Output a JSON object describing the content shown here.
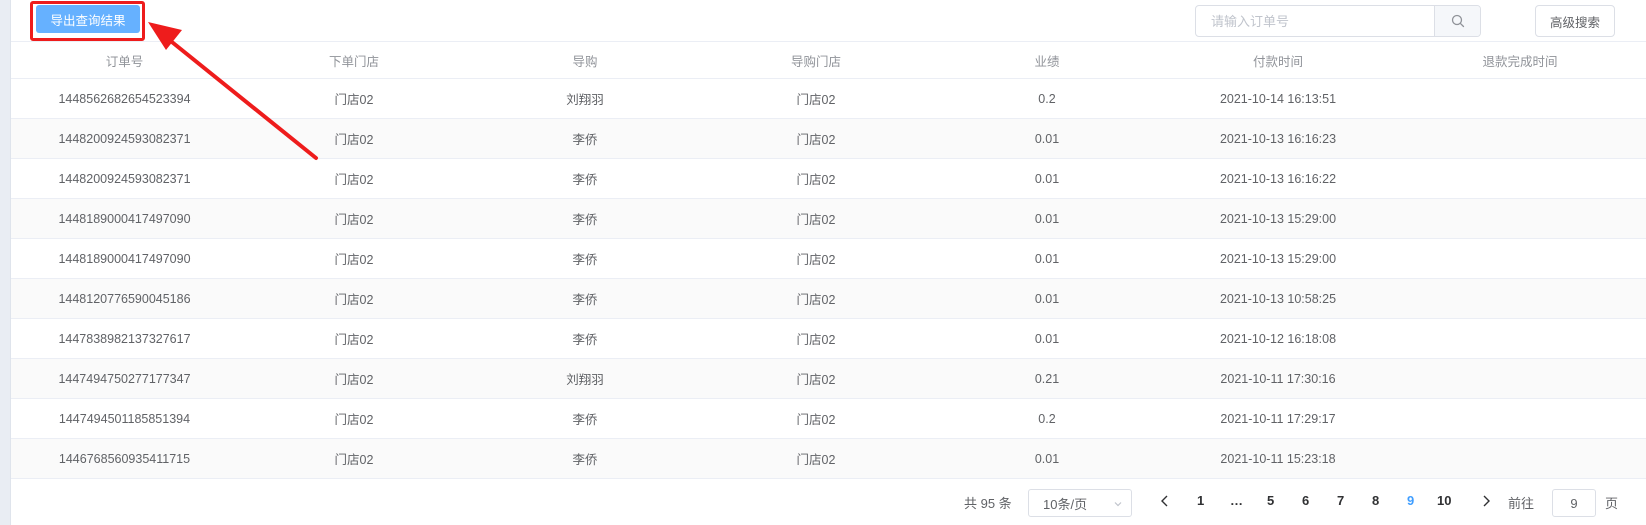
{
  "toolbar": {
    "export_label": "导出查询结果",
    "search_placeholder": "请输入订单号",
    "search_value": "",
    "advanced_label": "高级搜索"
  },
  "table": {
    "headers": [
      "订单号",
      "下单门店",
      "导购",
      "导购门店",
      "业绩",
      "付款时间",
      "退款完成时间"
    ],
    "rows": [
      [
        "1448562682654523394",
        "门店02",
        "刘翔羽",
        "门店02",
        "0.2",
        "2021-10-14 16:13:51",
        ""
      ],
      [
        "1448200924593082371",
        "门店02",
        "李侨",
        "门店02",
        "0.01",
        "2021-10-13 16:16:23",
        ""
      ],
      [
        "1448200924593082371",
        "门店02",
        "李侨",
        "门店02",
        "0.01",
        "2021-10-13 16:16:22",
        ""
      ],
      [
        "1448189000417497090",
        "门店02",
        "李侨",
        "门店02",
        "0.01",
        "2021-10-13 15:29:00",
        ""
      ],
      [
        "1448189000417497090",
        "门店02",
        "李侨",
        "门店02",
        "0.01",
        "2021-10-13 15:29:00",
        ""
      ],
      [
        "1448120776590045186",
        "门店02",
        "李侨",
        "门店02",
        "0.01",
        "2021-10-13 10:58:25",
        ""
      ],
      [
        "1447838982137327617",
        "门店02",
        "李侨",
        "门店02",
        "0.01",
        "2021-10-12 16:18:08",
        ""
      ],
      [
        "1447494750277177347",
        "门店02",
        "刘翔羽",
        "门店02",
        "0.21",
        "2021-10-11 17:30:16",
        ""
      ],
      [
        "1447494501185851394",
        "门店02",
        "李侨",
        "门店02",
        "0.2",
        "2021-10-11 17:29:17",
        ""
      ],
      [
        "1446768560935411715",
        "门店02",
        "李侨",
        "门店02",
        "0.01",
        "2021-10-11 15:23:18",
        ""
      ]
    ]
  },
  "pagination": {
    "total_text": "共 95 条",
    "page_size": "10条/页",
    "pages": [
      "1",
      "…",
      "5",
      "6",
      "7",
      "8",
      "9",
      "10"
    ],
    "current": "9",
    "goto_label": "前往",
    "goto_value": "9",
    "unit_label": "页"
  },
  "colors": {
    "primary": "#409eff",
    "export_button": "#66b1ff",
    "annotation": "#ee1c1c"
  }
}
